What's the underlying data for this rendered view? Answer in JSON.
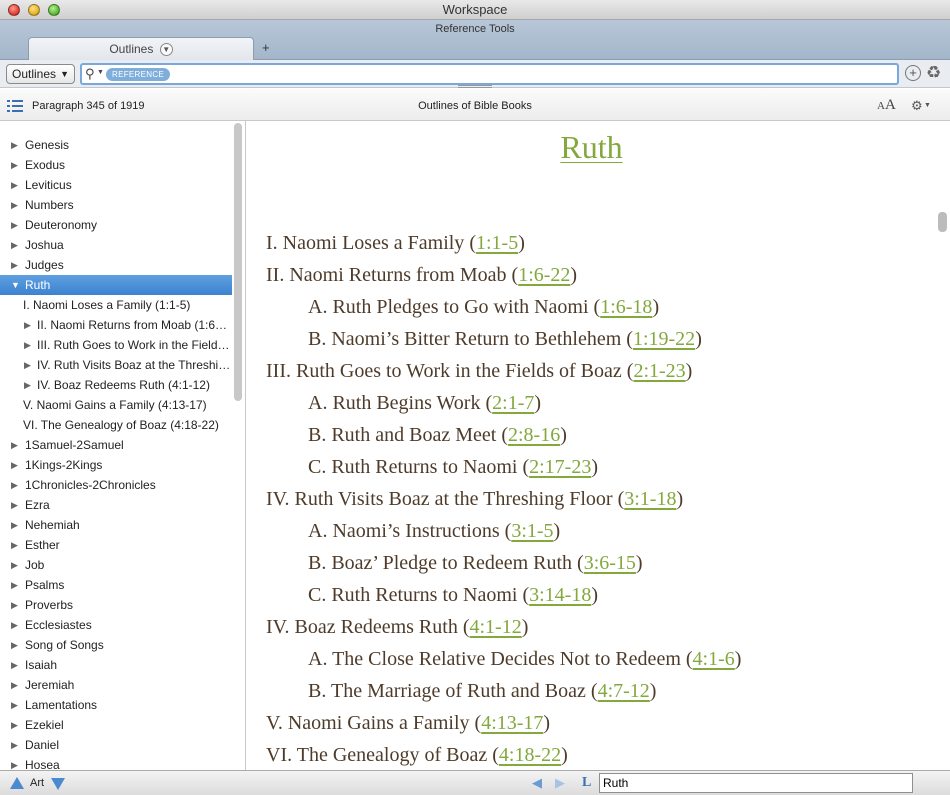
{
  "window": {
    "title": "Workspace"
  },
  "reftools": {
    "label": "Reference Tools",
    "tab_label": "Outlines",
    "tab_caret": "▼",
    "add_tab": "+"
  },
  "searchbar": {
    "dropdown_value": "Outlines",
    "dropdown_caret": "▼",
    "token": "REFERENCE",
    "query": "",
    "add_button": "+"
  },
  "infobar": {
    "position": "Paragraph 345 of 1919",
    "resource_title": "Outlines of Bible Books",
    "font_small": "A",
    "font_big": "A"
  },
  "sidebar": {
    "items": [
      {
        "label": "Genesis",
        "level": 0,
        "expanded": false
      },
      {
        "label": "Exodus",
        "level": 0,
        "expanded": false
      },
      {
        "label": "Leviticus",
        "level": 0,
        "expanded": false
      },
      {
        "label": "Numbers",
        "level": 0,
        "expanded": false
      },
      {
        "label": "Deuteronomy",
        "level": 0,
        "expanded": false
      },
      {
        "label": "Joshua",
        "level": 0,
        "expanded": false
      },
      {
        "label": "Judges",
        "level": 0,
        "expanded": false
      },
      {
        "label": "Ruth",
        "level": 0,
        "expanded": true,
        "selected": true
      },
      {
        "label": "I. Naomi Loses a Family (1:1-5)",
        "level": 1,
        "leaf": true
      },
      {
        "label": "II. Naomi Returns from Moab (1:6…",
        "level": 1
      },
      {
        "label": "III. Ruth Goes to Work in the Field…",
        "level": 1
      },
      {
        "label": "IV. Ruth Visits Boaz at the Threshi…",
        "level": 1
      },
      {
        "label": "IV. Boaz Redeems Ruth (4:1-12)",
        "level": 1
      },
      {
        "label": "V. Naomi Gains a Family (4:13-17)",
        "level": 1,
        "leaf": true
      },
      {
        "label": "VI. The Genealogy of Boaz (4:18-22)",
        "level": 1,
        "leaf": true
      },
      {
        "label": "1Samuel-2Samuel",
        "level": 0,
        "expanded": false
      },
      {
        "label": "1Kings-2Kings",
        "level": 0,
        "expanded": false
      },
      {
        "label": "1Chronicles-2Chronicles",
        "level": 0,
        "expanded": false
      },
      {
        "label": "Ezra",
        "level": 0,
        "expanded": false
      },
      {
        "label": "Nehemiah",
        "level": 0,
        "expanded": false
      },
      {
        "label": "Esther",
        "level": 0,
        "expanded": false
      },
      {
        "label": "Job",
        "level": 0,
        "expanded": false
      },
      {
        "label": "Psalms",
        "level": 0,
        "expanded": false
      },
      {
        "label": "Proverbs",
        "level": 0,
        "expanded": false
      },
      {
        "label": "Ecclesiastes",
        "level": 0,
        "expanded": false
      },
      {
        "label": "Song of Songs",
        "level": 0,
        "expanded": false
      },
      {
        "label": "Isaiah",
        "level": 0,
        "expanded": false
      },
      {
        "label": "Jeremiah",
        "level": 0,
        "expanded": false
      },
      {
        "label": "Lamentations",
        "level": 0,
        "expanded": false
      },
      {
        "label": "Ezekiel",
        "level": 0,
        "expanded": false
      },
      {
        "label": "Daniel",
        "level": 0,
        "expanded": false
      },
      {
        "label": "Hosea",
        "level": 0,
        "expanded": false
      }
    ]
  },
  "content": {
    "title": "Ruth",
    "lines": [
      {
        "level": 0,
        "text": "I. Naomi Loses a Family",
        "ref": "1:1-5"
      },
      {
        "level": 0,
        "text": "II. Naomi Returns from Moab",
        "ref": "1:6-22"
      },
      {
        "level": 1,
        "text": "A. Ruth Pledges to Go with Naomi",
        "ref": "1:6-18"
      },
      {
        "level": 1,
        "text": "B. Naomi’s Bitter Return to Bethlehem",
        "ref": "1:19-22"
      },
      {
        "level": 0,
        "text": "III. Ruth Goes to Work in the Fields of Boaz",
        "ref": "2:1-23"
      },
      {
        "level": 1,
        "text": "A. Ruth Begins Work",
        "ref": "2:1-7"
      },
      {
        "level": 1,
        "text": "B. Ruth and Boaz Meet",
        "ref": "2:8-16"
      },
      {
        "level": 1,
        "text": "C. Ruth Returns to Naomi",
        "ref": "2:17-23"
      },
      {
        "level": 0,
        "text": "IV. Ruth Visits Boaz at the Threshing Floor",
        "ref": "3:1-18"
      },
      {
        "level": 1,
        "text": "A. Naomi’s Instructions",
        "ref": "3:1-5"
      },
      {
        "level": 1,
        "text": "B. Boaz’ Pledge to Redeem Ruth",
        "ref": "3:6-15"
      },
      {
        "level": 1,
        "text": "C. Ruth Returns to Naomi",
        "ref": "3:14-18"
      },
      {
        "level": 0,
        "text": "IV. Boaz Redeems Ruth",
        "ref": "4:1-12"
      },
      {
        "level": 1,
        "text": "A. The Close Relative Decides Not to Redeem",
        "ref": "4:1-6"
      },
      {
        "level": 1,
        "text": "B. The Marriage of Ruth and Boaz",
        "ref": "4:7-12"
      },
      {
        "level": 0,
        "text": "V. Naomi Gains a Family",
        "ref": "4:13-17"
      },
      {
        "level": 0,
        "text": "VI. The Genealogy of Boaz",
        "ref": "4:18-22"
      }
    ]
  },
  "bottombar": {
    "art_label": "Art",
    "reference_value": "Ruth"
  },
  "colors": {
    "link_green": "#82a83e",
    "outline_text": "#4e3b2a",
    "selection_blue": "#3c82d0"
  }
}
